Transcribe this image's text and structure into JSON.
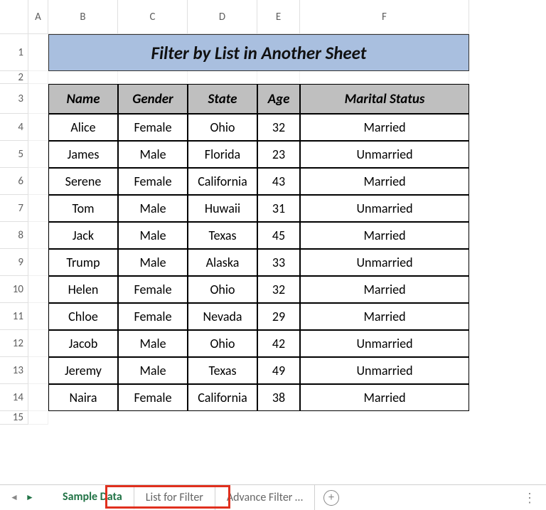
{
  "columns": [
    "A",
    "B",
    "C",
    "D",
    "E",
    "F"
  ],
  "rows": [
    "1",
    "2",
    "3",
    "4",
    "5",
    "6",
    "7",
    "8",
    "9",
    "10",
    "11",
    "12",
    "13",
    "14",
    "15"
  ],
  "title": "Filter by List in Another Sheet",
  "chart_data": {
    "type": "table",
    "headers": [
      "Name",
      "Gender",
      "State",
      "Age",
      "Marital Status"
    ],
    "rows": [
      [
        "Alice",
        "Female",
        "Ohio",
        "32",
        "Married"
      ],
      [
        "James",
        "Male",
        "Florida",
        "23",
        "Unmarried"
      ],
      [
        "Serene",
        "Female",
        "California",
        "43",
        "Married"
      ],
      [
        "Tom",
        "Male",
        "Huwaii",
        "31",
        "Unmarried"
      ],
      [
        "Jack",
        "Male",
        "Texas",
        "45",
        "Married"
      ],
      [
        "Trump",
        "Male",
        "Alaska",
        "33",
        "Unmarried"
      ],
      [
        "Helen",
        "Female",
        "Ohio",
        "32",
        "Married"
      ],
      [
        "Chloe",
        "Female",
        "Nevada",
        "29",
        "Married"
      ],
      [
        "Jacob",
        "Male",
        "Ohio",
        "42",
        "Unmarried"
      ],
      [
        "Jeremy",
        "Male",
        "Texas",
        "49",
        "Unmarried"
      ],
      [
        "Naira",
        "Female",
        "California",
        "38",
        "Married"
      ]
    ]
  },
  "tabs": {
    "active": "Sample Data",
    "others": [
      "List for Filter",
      "Advance Filter  …"
    ]
  }
}
